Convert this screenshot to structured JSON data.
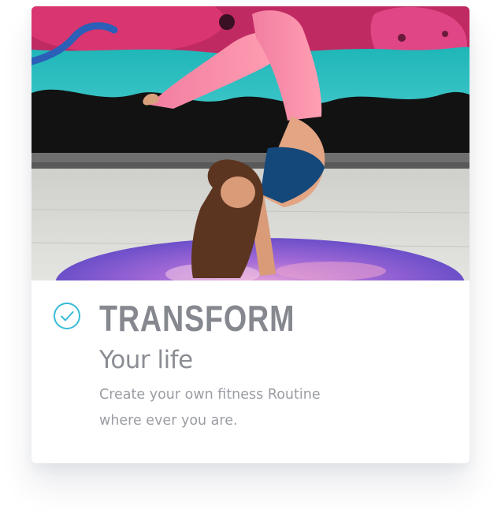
{
  "card": {
    "title": "TRANSFORM",
    "subtitle": "Your life",
    "description": "Create your own fitness Routine where ever you are.",
    "image_subject": "woman-yoga-pose-graffiti-wall",
    "status_icon": "check-circle-icon"
  },
  "colors": {
    "accent": "#35bcd6",
    "title": "#86888f",
    "text": "#9a9ca3",
    "card_bg": "#ffffff"
  }
}
